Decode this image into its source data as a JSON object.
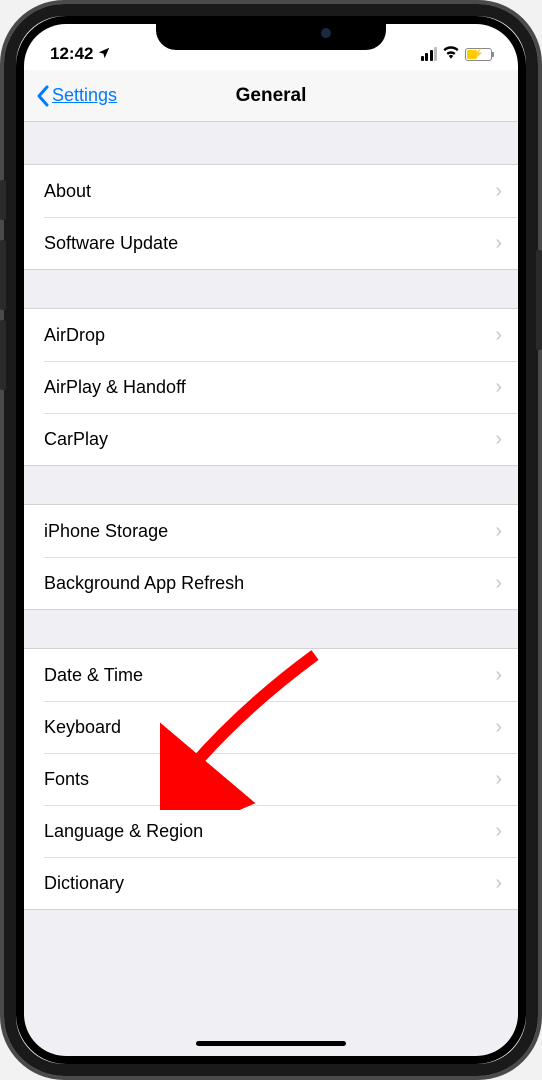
{
  "status": {
    "time": "12:42"
  },
  "nav": {
    "back_label": "Settings",
    "title": "General"
  },
  "groups": [
    {
      "items": [
        {
          "id": "about",
          "label": "About"
        },
        {
          "id": "software-update",
          "label": "Software Update"
        }
      ]
    },
    {
      "items": [
        {
          "id": "airdrop",
          "label": "AirDrop"
        },
        {
          "id": "airplay-handoff",
          "label": "AirPlay & Handoff"
        },
        {
          "id": "carplay",
          "label": "CarPlay"
        }
      ]
    },
    {
      "items": [
        {
          "id": "iphone-storage",
          "label": "iPhone Storage"
        },
        {
          "id": "background-app-refresh",
          "label": "Background App Refresh"
        }
      ]
    },
    {
      "items": [
        {
          "id": "date-time",
          "label": "Date & Time"
        },
        {
          "id": "keyboard",
          "label": "Keyboard"
        },
        {
          "id": "fonts",
          "label": "Fonts"
        },
        {
          "id": "language-region",
          "label": "Language & Region"
        },
        {
          "id": "dictionary",
          "label": "Dictionary"
        }
      ]
    }
  ],
  "annotation": {
    "target": "keyboard",
    "color": "#ff0000"
  }
}
